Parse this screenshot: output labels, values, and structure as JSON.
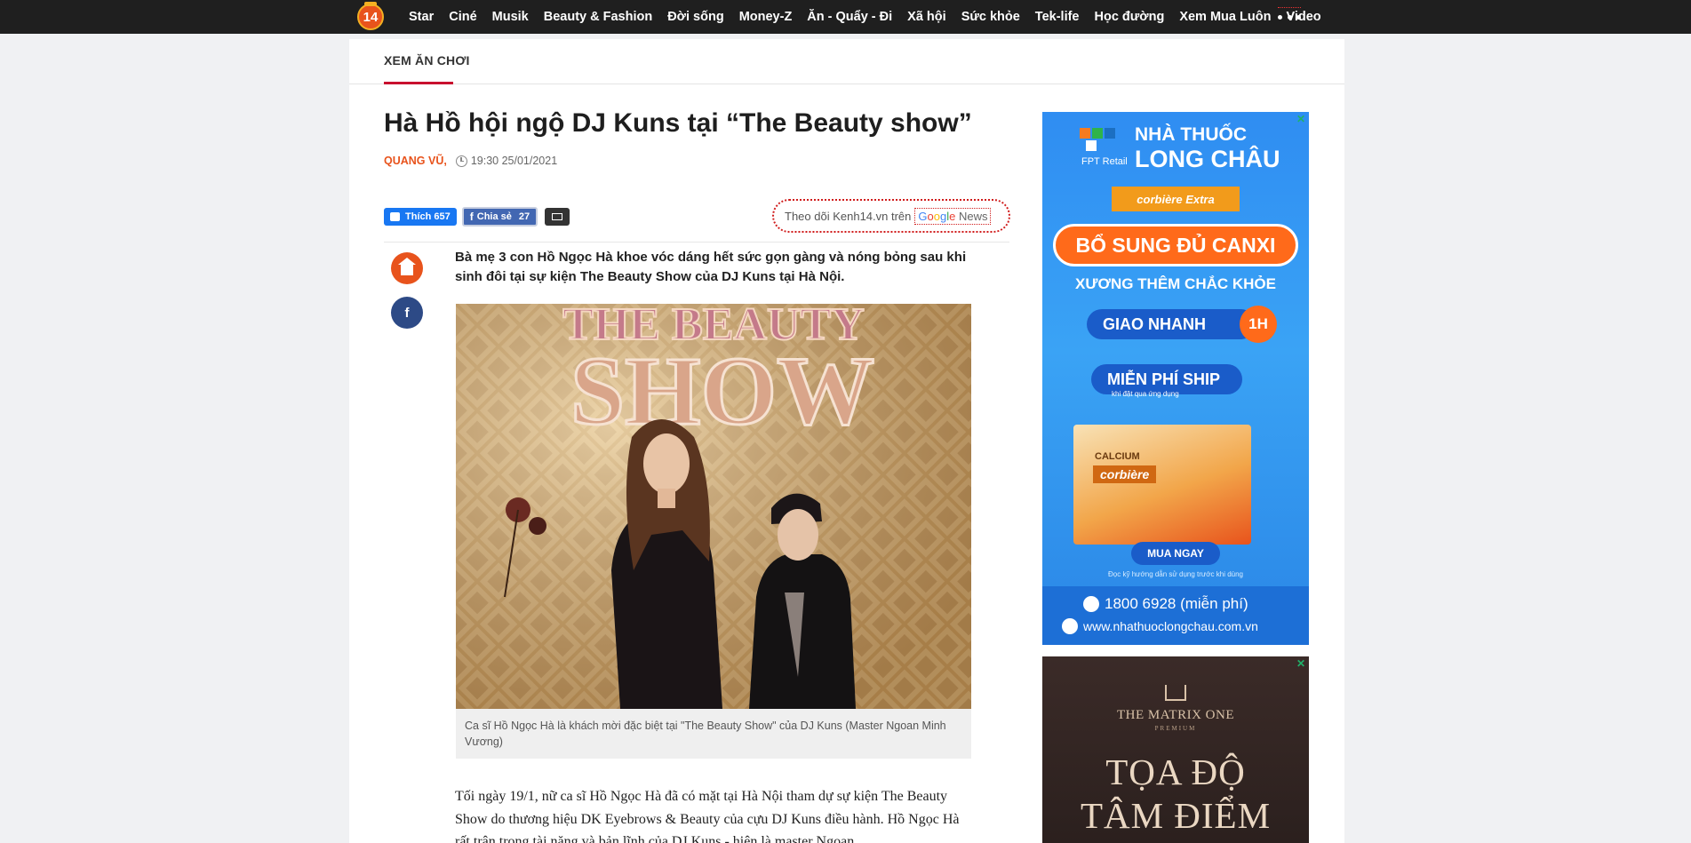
{
  "nav": {
    "logo_text": "14",
    "items": [
      "Star",
      "Ciné",
      "Musik",
      "Beauty & Fashion",
      "Đời sống",
      "Money-Z",
      "Ăn - Quẩy - Đi",
      "Xã hội",
      "Sức khỏe",
      "Tek-life",
      "Học đường",
      "Xem Mua Luôn",
      "Video"
    ]
  },
  "category": "XEM ĂN CHƠI",
  "article": {
    "title": "Hà Hồ hội ngộ DJ Kuns tại “The Beauty show”",
    "author": "QUANG VŨ,",
    "time": "19:30 25/01/2021",
    "sapo": "Bà mẹ 3 con Hồ Ngọc Hà khoe vóc dáng hết sức gọn gàng và nóng bỏng sau khi sinh đôi tại sự kiện The Beauty Show của DJ Kuns tại Hà Nội.",
    "photo_sign": [
      "THE BEAUTY",
      "SHOW"
    ],
    "caption": "Ca sĩ Hồ Ngọc Hà là khách mời đặc biệt tại \"The Beauty Show\" của DJ Kuns (Master Ngoan Minh Vương)",
    "body": "Tối ngày 19/1, nữ ca sĩ Hồ Ngọc Hà đã có mặt tại Hà Nội tham dự sự kiện The Beauty Show do thương hiệu DK Eyebrows & Beauty của cựu DJ Kuns điều hành. Hồ Ngọc Hà rất trân trọng tài năng và bản lĩnh của DJ Kuns - hiện là master Ngoan"
  },
  "share": {
    "like_label": "Thích",
    "like_count": "657",
    "share_label": "Chia sẻ",
    "share_count": "27"
  },
  "gnews": {
    "prefix": "Theo dõi Kenh14.vn trên",
    "g": [
      "G",
      "o",
      "o",
      "g",
      "l",
      "e"
    ],
    "news": "News"
  },
  "side_share": {
    "fb": "f"
  },
  "ad1": {
    "fpt": "FPT Retail",
    "brand1": "NHÀ THUỐC",
    "brand2": "LONG CHÂU",
    "corb_small": "corbière Extra",
    "headline": "BỔ SUNG ĐỦ CANXI",
    "subline": "XƯƠNG THÊM CHẮC KHỎE",
    "pill1": "GIAO NHANH",
    "badge": "1H",
    "pill2": "MIỄN PHÍ SHIP",
    "ship_sub": "khi đặt qua ứng dụng",
    "product_cal": "CALCIUM",
    "product_corb": "corbière",
    "buy": "MUA NGAY",
    "tiny": "Đọc kỹ hướng dẫn sử dụng trước khi dùng",
    "phone": "1800 6928 (miễn phí)",
    "web": "www.nhathuoclongchau.com.vn"
  },
  "ad2": {
    "line1": "THE MATRIX ONE",
    "line2": "PREMIUM",
    "head1": "TỌA ĐỘ",
    "head2": "TÂM ĐIỂM"
  },
  "colors": {
    "nav_bg": "#1f1f1f",
    "accent_orange": "#e8531c",
    "category_underline": "#c8102e",
    "facebook_blue": "#1877f2"
  }
}
